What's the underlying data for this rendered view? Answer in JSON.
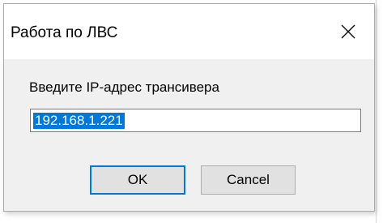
{
  "dialog": {
    "title": "Работа по ЛВС",
    "prompt": "Введите IP-адрес трансивера",
    "ip_value": "192.168.1.221",
    "ok_label": "OK",
    "cancel_label": "Cancel",
    "close_icon": "close-icon"
  },
  "colors": {
    "selection": "#0078d7",
    "dialog_bg": "#f0f0f0",
    "button_bg": "#e1e1e1"
  }
}
